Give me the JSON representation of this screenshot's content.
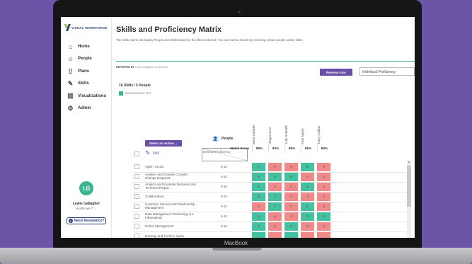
{
  "device_label": "MacBook",
  "app": {
    "logo_text": "VISUAL WORKFORCE",
    "page_title": "Skills and Proficiency Matrix",
    "subtitle": "The skills matrix will display People and Skills based on the filters selected. You can narrow results by selecting certain people and/or skills.",
    "reported_by_label": "REPORTED BY",
    "reported_by_value": "Lewis Gallagher on 09/18/20",
    "reverse_axis_label": "Reverse Axis",
    "view_select_value": "Individual Proficiency",
    "counts_text": "16 Skills / 5 People",
    "legend_text": "REQUIREMENT MET",
    "select_action_label": "Select an Action",
    "people_label": "People",
    "skill_label": "Skill",
    "desired_label": "Desired Proficiency",
    "match_score_label": "Match Score"
  },
  "sidebar": {
    "items": [
      {
        "label": "Home",
        "icon": "home-icon"
      },
      {
        "label": "People",
        "icon": "people-icon"
      },
      {
        "label": "Plans",
        "icon": "plans-icon"
      },
      {
        "label": "Skills",
        "icon": "skills-icon"
      },
      {
        "label": "Visualizations",
        "icon": "chart-icon"
      },
      {
        "label": "Admin",
        "icon": "gear-icon"
      }
    ],
    "avatar_initials": "LG",
    "user_name": "Lewis Gallagher",
    "user_group": "Healthcare IT",
    "assist_label": "Need Assistance?"
  },
  "people": [
    "Beryl Gardner",
    "Ginger Cruz",
    "Julie Schmidt",
    "Kate Myers",
    "Tracy Collins"
  ],
  "match_scores": [
    "98%",
    "93%",
    "86%",
    "65%",
    "80%"
  ],
  "colors": {
    "met": "#45c1a0",
    "not_met": "#f08a8a",
    "accent": "#6b4fa6"
  },
  "rows": [
    {
      "skill": "Agile / Scrum",
      "desired": "5-10",
      "values": [
        "7",
        "4",
        "4",
        "5",
        "4"
      ],
      "met": [
        true,
        false,
        false,
        true,
        false
      ]
    },
    {
      "skill": "Analyze and Classify Complex Change Requests",
      "desired": "5-10",
      "values": [
        "6",
        "5",
        "6",
        "3",
        "4"
      ],
      "met": [
        true,
        true,
        true,
        false,
        false
      ]
    },
    {
      "skill": "Analyze and Evaluate Business and Technical Requir...",
      "desired": "5-10",
      "values": [
        "6",
        "4",
        "4",
        "5",
        "4"
      ],
      "met": [
        true,
        false,
        false,
        true,
        false
      ]
    },
    {
      "skill": "Collaboration",
      "desired": "5-10",
      "values": [
        "5",
        "7",
        "4",
        "4",
        "4"
      ],
      "met": [
        true,
        true,
        false,
        false,
        false
      ]
    },
    {
      "skill": "Customer Service and Relationship Management",
      "desired": "5-10",
      "values": [
        "4",
        "7",
        "3",
        "5",
        "4"
      ],
      "met": [
        false,
        true,
        false,
        true,
        false
      ]
    },
    {
      "skill": "Data Management Technology (i.e. Informatica)",
      "desired": "5-10",
      "values": [
        "5",
        "4",
        "3",
        "5",
        "5"
      ],
      "met": [
        true,
        false,
        false,
        true,
        true
      ]
    },
    {
      "skill": "Defect Management",
      "desired": "5-10",
      "values": [
        "6",
        "4",
        "6",
        "3",
        "4"
      ],
      "met": [
        true,
        false,
        true,
        false,
        false
      ]
    },
    {
      "skill": "Develop and Perform Syste",
      "desired": "",
      "values": [
        "",
        "",
        "",
        "",
        ""
      ],
      "met": [
        true,
        false,
        true,
        false,
        false
      ]
    }
  ]
}
